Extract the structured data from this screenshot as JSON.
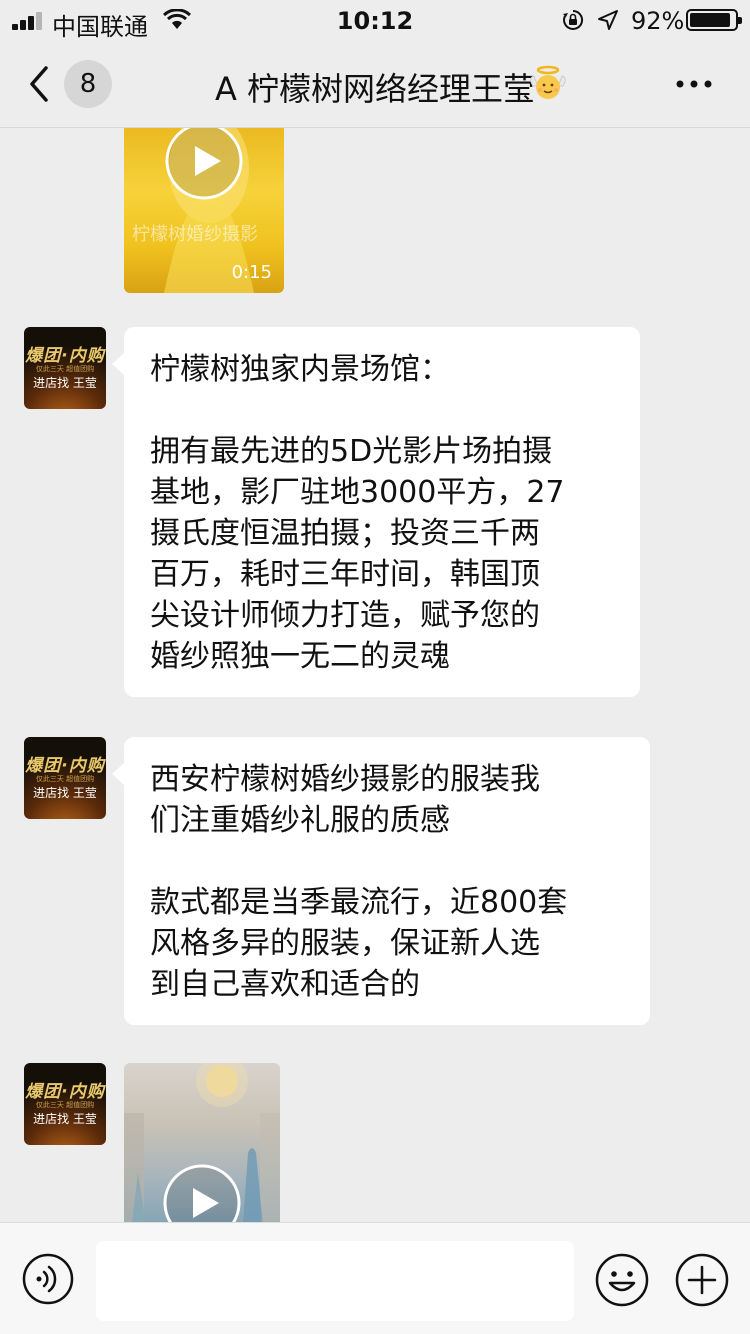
{
  "status_bar": {
    "carrier": "中国联通",
    "time": "10:12",
    "battery_percent": "92%",
    "battery_level": 0.92,
    "icons": [
      "signal-icon",
      "wifi-icon",
      "orientation-lock-icon",
      "location-icon",
      "battery-icon"
    ]
  },
  "nav": {
    "back_icon": "chevron-left-icon",
    "unread_count": "8",
    "title": "A 柠檬树网络经理王莹",
    "title_emoji": "baby-angel-emoji",
    "more_icon": "more-icon"
  },
  "messages": [
    {
      "type": "video",
      "caption": "柠檬树婚纱摄影",
      "duration": "0:15"
    },
    {
      "type": "text",
      "avatar": {
        "line1": "爆团·内购",
        "line2": "仅此三天 超值团购",
        "line3": "进店找 王莹"
      },
      "text": "柠檬树独家内景场馆：\n\n拥有最先进的5D光影片场拍摄\n基地，影厂驻地3000平方，27\n摄氏度恒温拍摄；投资三千两\n百万，耗时三年时间，韩国顶\n尖设计师倾力打造，赋予您的\n婚纱照独一无二的灵魂"
    },
    {
      "type": "text",
      "avatar": {
        "line1": "爆团·内购",
        "line2": "仅此三天 超值团购",
        "line3": "进店找 王莹"
      },
      "text": "西安柠檬树婚纱摄影的服装我\n们注重婚纱礼服的质感\n\n款式都是当季最流行，近800套\n风格多异的服装，保证新人选\n到自己喜欢和适合的"
    },
    {
      "type": "video",
      "avatar": {
        "line1": "爆团·内购",
        "line2": "仅此三天 超值团购",
        "line3": "进店找 王莹"
      }
    }
  ],
  "input_bar": {
    "placeholder": "",
    "voice_icon": "voice-icon",
    "emoji_icon": "emoji-icon",
    "plus_icon": "plus-icon"
  },
  "colors": {
    "background": "#ededed",
    "bubble": "#ffffff",
    "input_bar": "#f7f7f7",
    "text": "#111111"
  }
}
